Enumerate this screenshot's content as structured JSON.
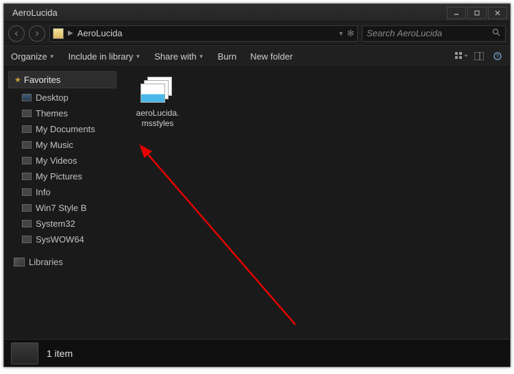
{
  "window": {
    "title": "AeroLucida"
  },
  "nav": {
    "crumb": "AeroLucida",
    "search_placeholder": "Search AeroLucida"
  },
  "toolbar": {
    "organize": "Organize",
    "include": "Include in library",
    "share": "Share with",
    "burn": "Burn",
    "newfolder": "New folder"
  },
  "sidebar": {
    "favorites_header": "Favorites",
    "libraries_header": "Libraries",
    "favorites": [
      {
        "label": "Desktop"
      },
      {
        "label": "Themes"
      },
      {
        "label": "My Documents"
      },
      {
        "label": "My Music"
      },
      {
        "label": "My Videos"
      },
      {
        "label": "My Pictures"
      },
      {
        "label": "Info"
      },
      {
        "label": "Win7 Style B"
      },
      {
        "label": "System32"
      },
      {
        "label": "SysWOW64"
      }
    ]
  },
  "content": {
    "file_name": "aeroLucida.msstyles"
  },
  "status": {
    "count_text": "1 item"
  }
}
